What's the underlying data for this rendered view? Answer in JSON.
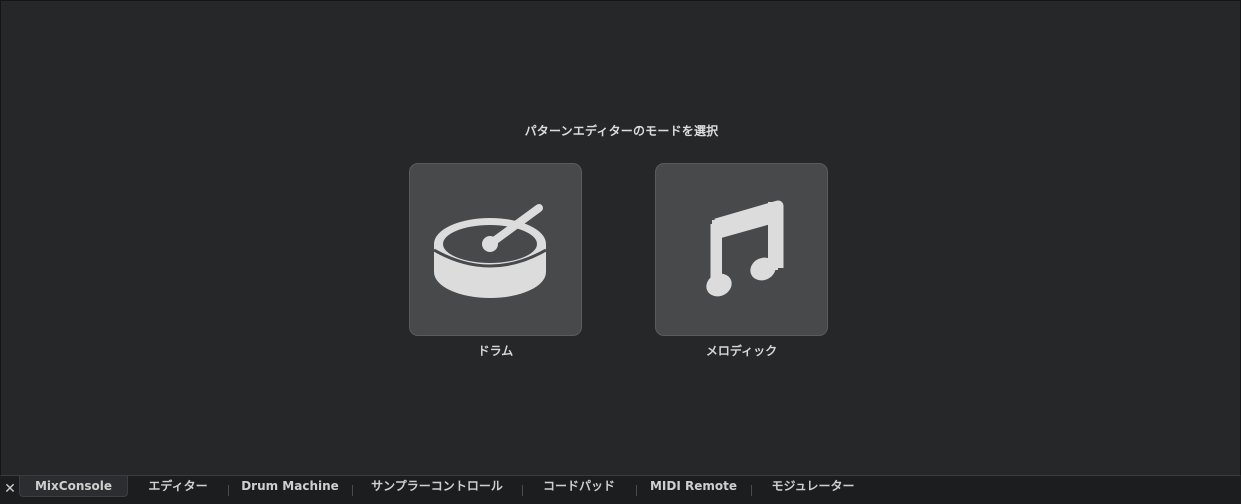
{
  "prompt": "パターンエディターのモードを選択",
  "modes": [
    {
      "label": "ドラム",
      "icon": "drum-icon"
    },
    {
      "label": "メロディック",
      "icon": "music-note-icon"
    }
  ],
  "tabbar": {
    "close_icon": "close-icon",
    "tabs": [
      {
        "label": "MixConsole",
        "active": true
      },
      {
        "label": "エディター",
        "active": false
      },
      {
        "label": "Drum Machine",
        "active": false
      },
      {
        "label": "サンプラーコントロール",
        "active": false
      },
      {
        "label": "コードパッド",
        "active": false
      },
      {
        "label": "MIDI Remote",
        "active": false
      },
      {
        "label": "モジュレーター",
        "active": false
      }
    ]
  },
  "colors": {
    "background": "#262729",
    "button": "#48494b",
    "icon": "#dcdcdc",
    "tabbar": "#1c1d1f"
  }
}
